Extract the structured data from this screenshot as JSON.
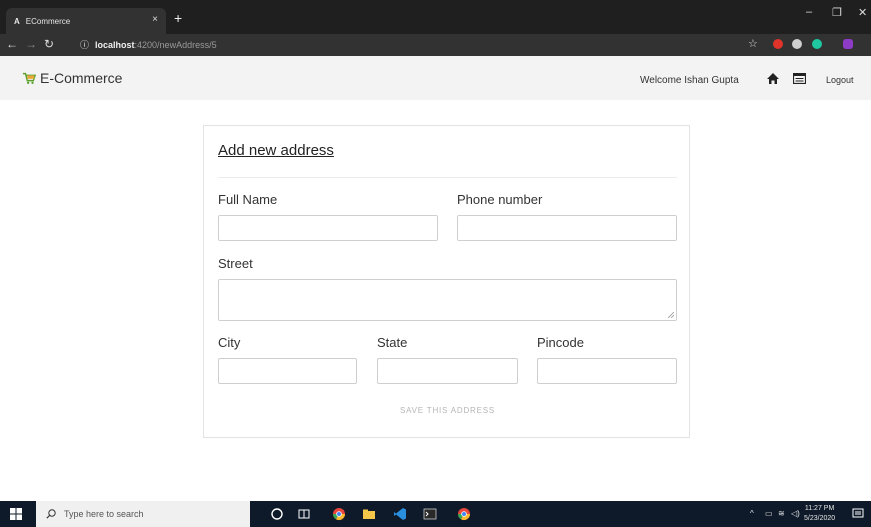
{
  "browser": {
    "tab_icon": "A",
    "tab_title": "ECommerce",
    "tab_close": "×",
    "new_tab": "+",
    "url_host": "localhost",
    "url_path": ":4200/newAddress/5",
    "info_icon": "ⓘ",
    "star": "☆",
    "minimize": "–",
    "maximize": "❐",
    "close": "✕"
  },
  "header": {
    "brand": "E-Commerce",
    "welcome": "Welcome Ishan Gupta",
    "logout": "Logout"
  },
  "form": {
    "title": "Add new address",
    "full_name_label": "Full Name",
    "phone_label": "Phone number",
    "street_label": "Street",
    "city_label": "City",
    "state_label": "State",
    "pincode_label": "Pincode",
    "full_name_value": "",
    "phone_value": "",
    "street_value": "",
    "city_value": "",
    "state_value": "",
    "pincode_value": "",
    "save_label": "SAVE THIS ADDRESS"
  },
  "taskbar": {
    "search_placeholder": "Type here to search",
    "time": "11:27 PM",
    "date": "5/23/2020"
  }
}
